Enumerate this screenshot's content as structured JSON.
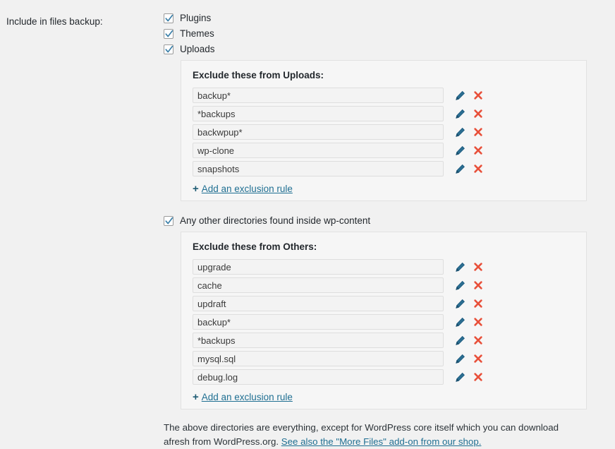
{
  "field_label": "Include in files backup:",
  "checkboxes": [
    {
      "label": "Plugins",
      "checked": true
    },
    {
      "label": "Themes",
      "checked": true
    },
    {
      "label": "Uploads",
      "checked": true
    }
  ],
  "uploads_panel": {
    "title": "Exclude these from Uploads:",
    "rules": [
      "backup*",
      "*backups",
      "backwpup*",
      "wp-clone",
      "snapshots"
    ],
    "add_label": "Add an exclusion rule",
    "add_plus": "+",
    "edit_icon": "pencil-icon",
    "delete_icon": "x-icon"
  },
  "other_checkbox": {
    "label": "Any other directories found inside wp-content",
    "checked": true
  },
  "others_panel": {
    "title": "Exclude these from Others:",
    "rules": [
      "upgrade",
      "cache",
      "updraft",
      "backup*",
      "*backups",
      "mysql.sql",
      "debug.log"
    ],
    "add_label": "Add an exclusion rule",
    "add_plus": "+",
    "edit_icon": "pencil-icon",
    "delete_icon": "x-icon"
  },
  "note": {
    "text_before": "The above directories are everything, except for WordPress core itself which you can download afresh from WordPress.org. ",
    "link_text": "See also the \"More Files\" add-on from our shop."
  },
  "colors": {
    "page_background": "#f1f1f1",
    "panel_border": "#e2e2e2",
    "panel_background": "#f6f6f6",
    "input_background": "#f3f3f3",
    "input_border": "#dedede",
    "link": "#1f6f92",
    "checkmark": "#3a7fa8",
    "pencil": "#1f5c80",
    "delete_x": "#e8503a",
    "text": "#23282d"
  }
}
